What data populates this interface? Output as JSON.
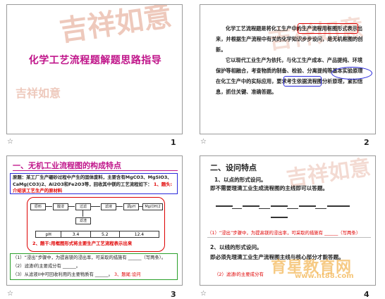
{
  "slides": [
    {
      "number": "1",
      "title": "化学工艺流程题解题思路指导",
      "calligraphy_big": "吉祥如意",
      "calligraphy_small": "吉祥如意"
    },
    {
      "number": "2",
      "paragraph1": "化学工艺流程题是将化工生产中的生产流程用框图形式表示出来，并根据生产流程中有关的化学知识步步设问，是无机框图的创新。",
      "paragraph2": "它以现代工业生产为依托，与化工生产成本、产品提纯、环境保护等相融合，考查物质的制备、检验、分离提纯等基本实验原理在化工生产中的实际应用，要求考生依据流程图分析原理，紧扣信息，抓住关键、准确答题。",
      "calligraphy": "吉祥如意"
    },
    {
      "number": "3",
      "heading": "一、无机工业流程图的构成特点",
      "intro": "原题：某工厂生产硼砂过程中产生的固体废料，主要含有MgCO3、MgSiO3、CaMg(CO3)2、Al2O3和Fe2O3等，回收其中镁的工艺流程如下：",
      "intro_note": "1、题头:介绍该工艺生产的原材料",
      "flow_boxes": [
        "原料",
        "酸浸",
        "过滤",
        "滤液",
        "调pH",
        "Mg(OH)2",
        "滤渣"
      ],
      "ph_row": [
        "pH",
        "3.4",
        "5.2",
        "12.4"
      ],
      "flow_note": "2、题干:用框图形式将主要生产工艺流程表示出来",
      "q1": "（1）“浸出”步骤中，为提高镁的浸出率，可采取的措施有 ______（写两条）。",
      "q2": "（2）滤渣I的主要成分有 ______。",
      "q3": "（3）从滤液II中可回收利用的主要物质有 ______。",
      "q3_note": "3、题尾:设问"
    },
    {
      "number": "4",
      "heading": "二、设问特点",
      "item1": "1、以点的形式设问。",
      "item1_desc": "即不需要理清工业生成流程图的主线即可以答题。",
      "answer1": "（1）“浸出”步骤中，为提高镁的浸出率，可采取的措施有 ______（写两条）",
      "item2": "2、以线的形式设问。",
      "item2_desc": "即必须先理清工业生产流程图主线与核心部分才能答题。",
      "q2": "（2）滤渣I的主要成分有",
      "calligraphy": "吉祥如意",
      "watermark": "育星教育网",
      "watermark_url": "www.ht88.com"
    }
  ],
  "star_icon": "☆"
}
